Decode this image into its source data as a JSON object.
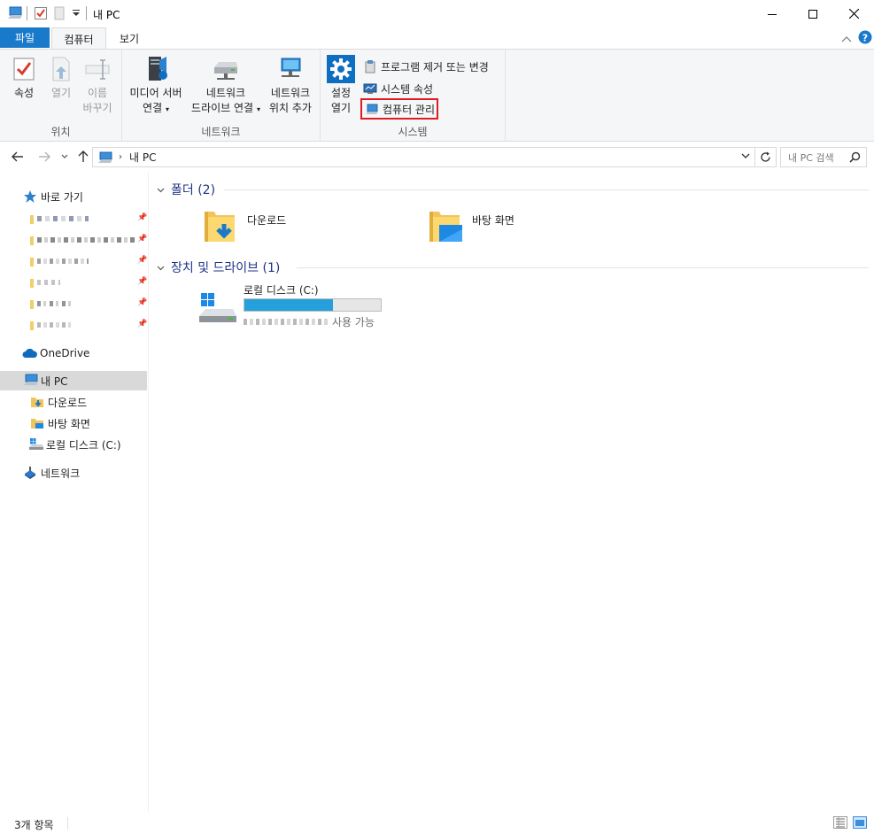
{
  "window": {
    "title": "내 PC",
    "minimize_label": "minimize",
    "maximize_label": "maximize",
    "close_label": "close"
  },
  "tabs": {
    "file": "파일",
    "computer": "컴퓨터",
    "view": "보기"
  },
  "ribbon": {
    "location": {
      "group_label": "위치",
      "properties": "속성",
      "open": "열기",
      "rename_line1": "이름",
      "rename_line2": "바꾸기"
    },
    "network": {
      "group_label": "네트워크",
      "media_line1": "미디어 서버",
      "media_line2": "연결",
      "map_drive_line1": "네트워크",
      "map_drive_line2": "드라이브 연결",
      "add_location_line1": "네트워크",
      "add_location_line2": "위치 추가"
    },
    "system": {
      "group_label": "시스템",
      "settings_line1": "설정",
      "settings_line2": "열기",
      "uninstall": "프로그램 제거 또는 변경",
      "system_props": "시스템 속성",
      "manage": "컴퓨터 관리"
    }
  },
  "address": {
    "path": "내 PC",
    "search_placeholder": "내 PC 검색"
  },
  "navpane": {
    "quick_access": "바로 가기",
    "onedrive": "OneDrive",
    "this_pc": "내 PC",
    "downloads": "다운로드",
    "desktop": "바탕 화면",
    "local_disk": "로컬 디스크 (C:)",
    "network": "네트워크"
  },
  "content": {
    "folders_header": "폴더 (2)",
    "folder_downloads": "다운로드",
    "folder_desktop": "바탕 화면",
    "drives_header": "장치 및 드라이브 (1)",
    "drive_name": "로컬 디스크 (C:)",
    "drive_free_suffix": "사용 가능",
    "drive_used_fraction": 0.65
  },
  "status": {
    "item_count": "3개 항목"
  },
  "colors": {
    "accent": "#1979ca",
    "highlight_box": "#e01b22",
    "drive_bar": "#26a0da",
    "section_header": "#1e3287"
  }
}
